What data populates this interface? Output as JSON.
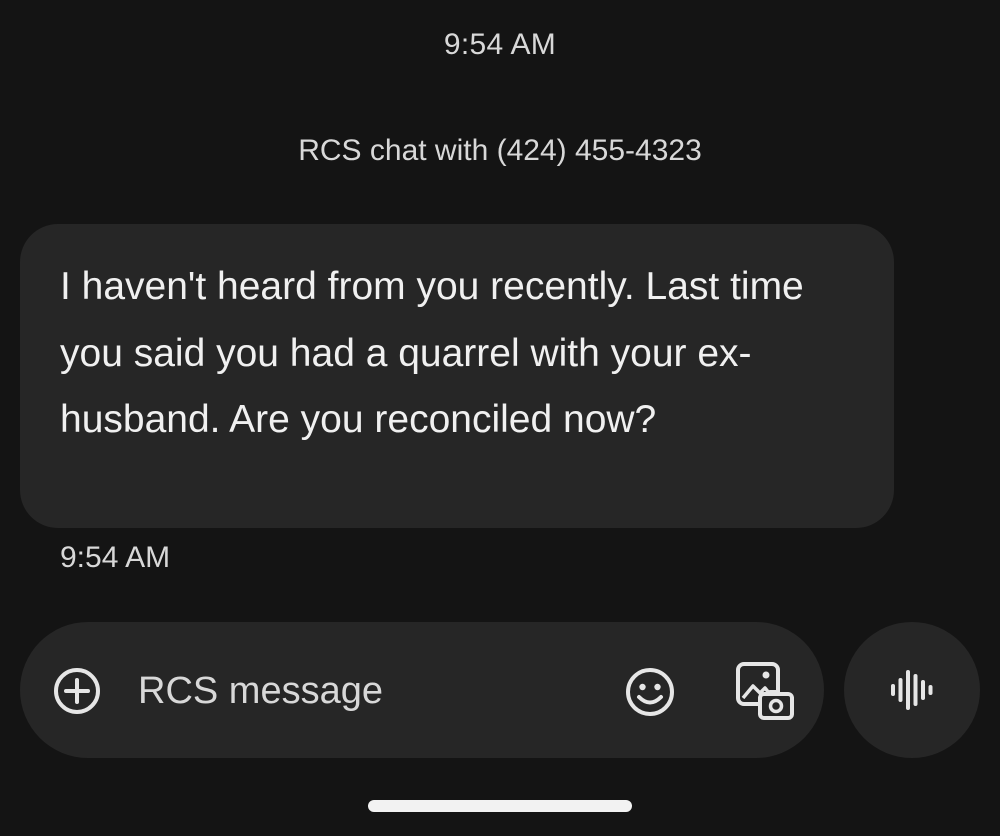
{
  "header": {
    "time": "9:54 AM",
    "chat_label": "RCS chat with (424) 455-4323"
  },
  "messages": [
    {
      "direction": "incoming",
      "text": "I haven't heard from you recently. Last time you said you had a quarrel with your ex-husband. Are you reconciled now?",
      "time": "9:54 AM"
    }
  ],
  "composer": {
    "placeholder": "RCS message",
    "value": "",
    "icons": [
      "add-circle-icon",
      "emoji-icon",
      "gallery-camera-icon"
    ]
  },
  "voice_button": {
    "icon": "voice-waveform-icon"
  },
  "colors": {
    "background": "#141414",
    "bubble": "#262626",
    "text": "#f0f0f0",
    "secondary_text": "#d8d8d8"
  }
}
